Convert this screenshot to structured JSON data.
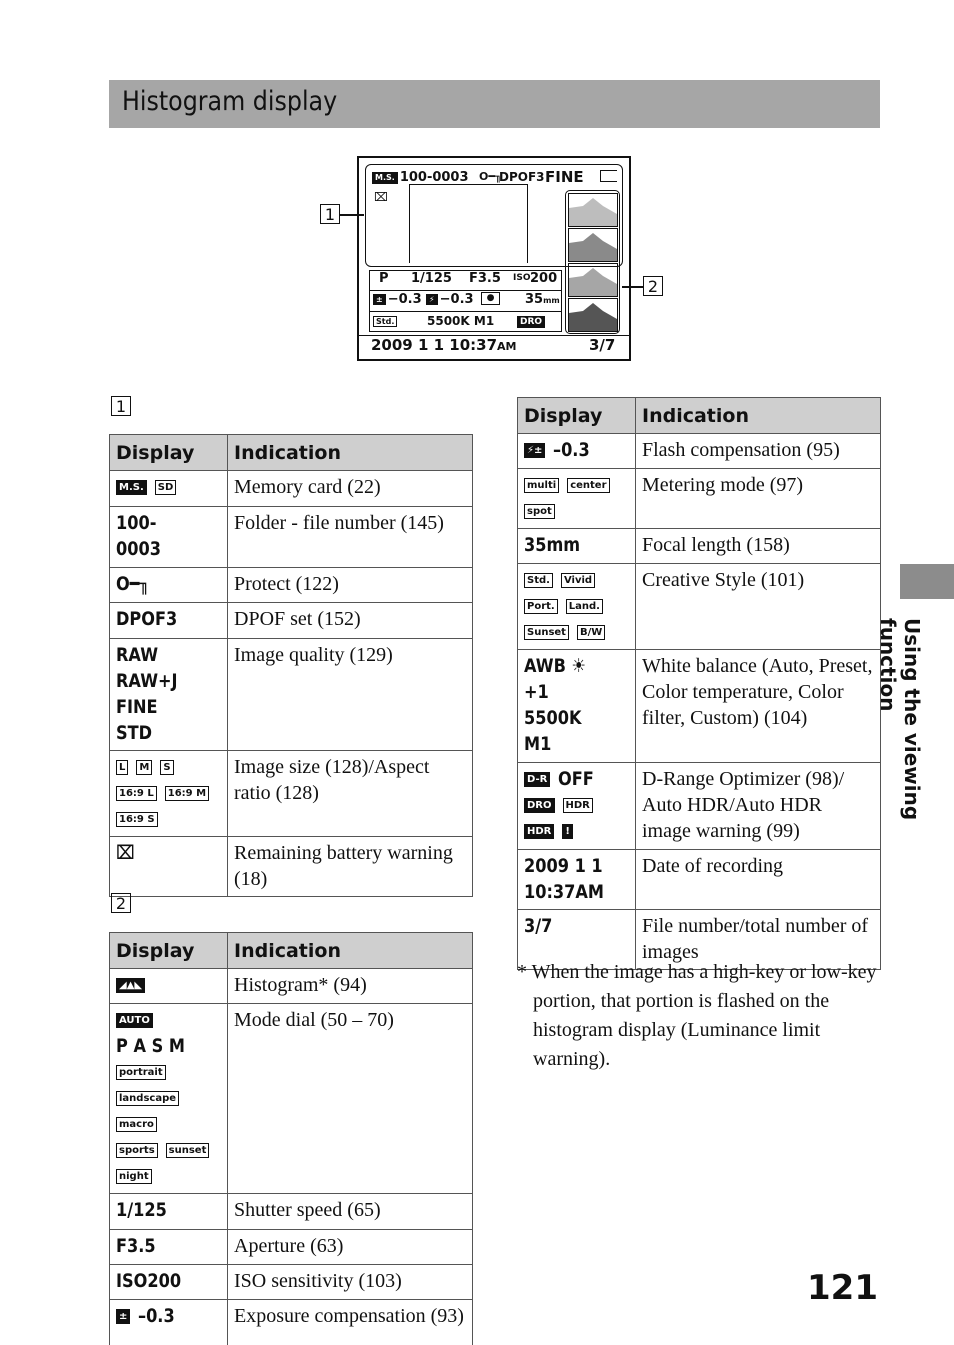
{
  "title": "Histogram display",
  "lcd": {
    "memory_icon": "M.S.",
    "folder_file": "100-0003",
    "protect_icon": "key-icon",
    "dpof": "DPOF3",
    "quality": "FINE",
    "size_icon": "image-size-L-icon",
    "mode": "P",
    "shutter": "1/125",
    "aperture": "F3.5",
    "iso_label": "ISO",
    "iso": "200",
    "exposure": "−0.3",
    "flash": "−0.3",
    "focal": "35",
    "focal_unit": "mm",
    "style": "Std.",
    "wb": "5500K M1",
    "dro": "DRO",
    "date": "2009   1   1 10:37",
    "ampm": "AM",
    "count": "3/7",
    "histogram_shades": [
      "#bdbdbd",
      "#8a8a8a",
      "#a6a6a6",
      "#555555"
    ]
  },
  "callouts": [
    "1",
    "2"
  ],
  "header": {
    "display": "Display",
    "indication": "Indication"
  },
  "table1": [
    {
      "display": [
        [
          {
            "i": "M.S.",
            "inv": true
          },
          {
            "i": "SD"
          }
        ]
      ],
      "indication": "Memory card (22)"
    },
    {
      "display": [
        [
          {
            "t": "100-0003"
          }
        ]
      ],
      "indication": "Folder - file number (145)"
    },
    {
      "display": [
        [
          {
            "t": "O━╖"
          }
        ]
      ],
      "indication": "Protect (122)"
    },
    {
      "display": [
        [
          {
            "t": "DPOF3"
          }
        ]
      ],
      "indication": "DPOF set (152)"
    },
    {
      "display": [
        [
          {
            "t": "RAW"
          }
        ],
        [
          {
            "t": "RAW+J"
          }
        ],
        [
          {
            "t": "FINE"
          }
        ],
        [
          {
            "t": "STD"
          }
        ]
      ],
      "indication": "Image quality (129)"
    },
    {
      "display": [
        [
          {
            "i": "L"
          },
          {
            "i": "M"
          },
          {
            "i": "S"
          }
        ],
        [
          {
            "i": "16:9 L"
          },
          {
            "i": "16:9 M"
          },
          {
            "i": "16:9 S"
          }
        ]
      ],
      "indication": "Image size (128)/Aspect ratio (128)"
    },
    {
      "display": [
        [
          {
            "t": "⌧"
          }
        ]
      ],
      "indication": "Remaining battery warning (18)"
    }
  ],
  "table2": [
    {
      "display": [
        [
          {
            "i": "◢▲◣",
            "inv": true
          }
        ]
      ],
      "indication": "Histogram* (94)"
    },
    {
      "display": [
        [
          {
            "i": "AUTO",
            "inv": true
          },
          {
            "t": "P A S M"
          }
        ],
        [
          {
            "i": "portrait"
          },
          {
            "i": "landscape"
          },
          {
            "i": "macro"
          }
        ],
        [
          {
            "i": "sports"
          },
          {
            "i": "sunset"
          },
          {
            "i": "night"
          }
        ]
      ],
      "indication": "Mode dial (50 – 70)"
    },
    {
      "display": [
        [
          {
            "t": "1/125"
          }
        ]
      ],
      "indication": "Shutter speed (65)"
    },
    {
      "display": [
        [
          {
            "t": "F3.5"
          }
        ]
      ],
      "indication": "Aperture (63)"
    },
    {
      "display": [
        [
          {
            "t": "ISO200"
          }
        ]
      ],
      "indication": "ISO sensitivity (103)"
    },
    {
      "display": [
        [
          {
            "i": "±",
            "inv": true
          },
          {
            "t": "–0.3"
          }
        ]
      ],
      "indication": "Exposure compensation (93)"
    }
  ],
  "table3": [
    {
      "display": [
        [
          {
            "i": "⚡±",
            "inv": true
          },
          {
            "t": "–0.3"
          }
        ]
      ],
      "indication": "Flash compensation (95)"
    },
    {
      "display": [
        [
          {
            "i": "multi"
          },
          {
            "i": "center"
          },
          {
            "i": "spot"
          }
        ]
      ],
      "indication": "Metering mode (97)"
    },
    {
      "display": [
        [
          {
            "t": "35mm"
          }
        ]
      ],
      "indication": "Focal length (158)"
    },
    {
      "display": [
        [
          {
            "i": "Std."
          },
          {
            "i": "Vivid"
          }
        ],
        [
          {
            "i": "Port."
          },
          {
            "i": "Land."
          }
        ],
        [
          {
            "i": "Sunset"
          },
          {
            "i": "B/W"
          }
        ]
      ],
      "indication": "Creative Style (101)"
    },
    {
      "display": [
        [
          {
            "t": "AWB ☀+1"
          }
        ],
        [
          {
            "t": "5500K M1"
          }
        ]
      ],
      "indication": "White balance (Auto, Preset, Color temperature, Color filter, Custom) (104)"
    },
    {
      "display": [
        [
          {
            "i": "D-R",
            "inv": true
          },
          {
            "t": "OFF"
          }
        ],
        [
          {
            "i": "DRO",
            "inv": true
          },
          {
            "i": "HDR"
          }
        ],
        [
          {
            "i": "HDR",
            "inv": true
          },
          {
            "i": "!",
            "inv": true
          }
        ]
      ],
      "indication": "D-Range Optimizer (98)/ Auto HDR/Auto HDR image warning (99)"
    },
    {
      "display": [
        [
          {
            "t": "2009  1  1"
          }
        ],
        [
          {
            "t": "10:37AM"
          }
        ]
      ],
      "indication": "Date of recording"
    },
    {
      "display": [
        [
          {
            "t": "3/7"
          }
        ]
      ],
      "indication": "File number/total number of images"
    }
  ],
  "footnote": "* When the image has a high-key or low-key portion, that portion is flashed on the histogram display (Luminance limit warning).",
  "side_tab": "Using the viewing function",
  "page_number": "121"
}
